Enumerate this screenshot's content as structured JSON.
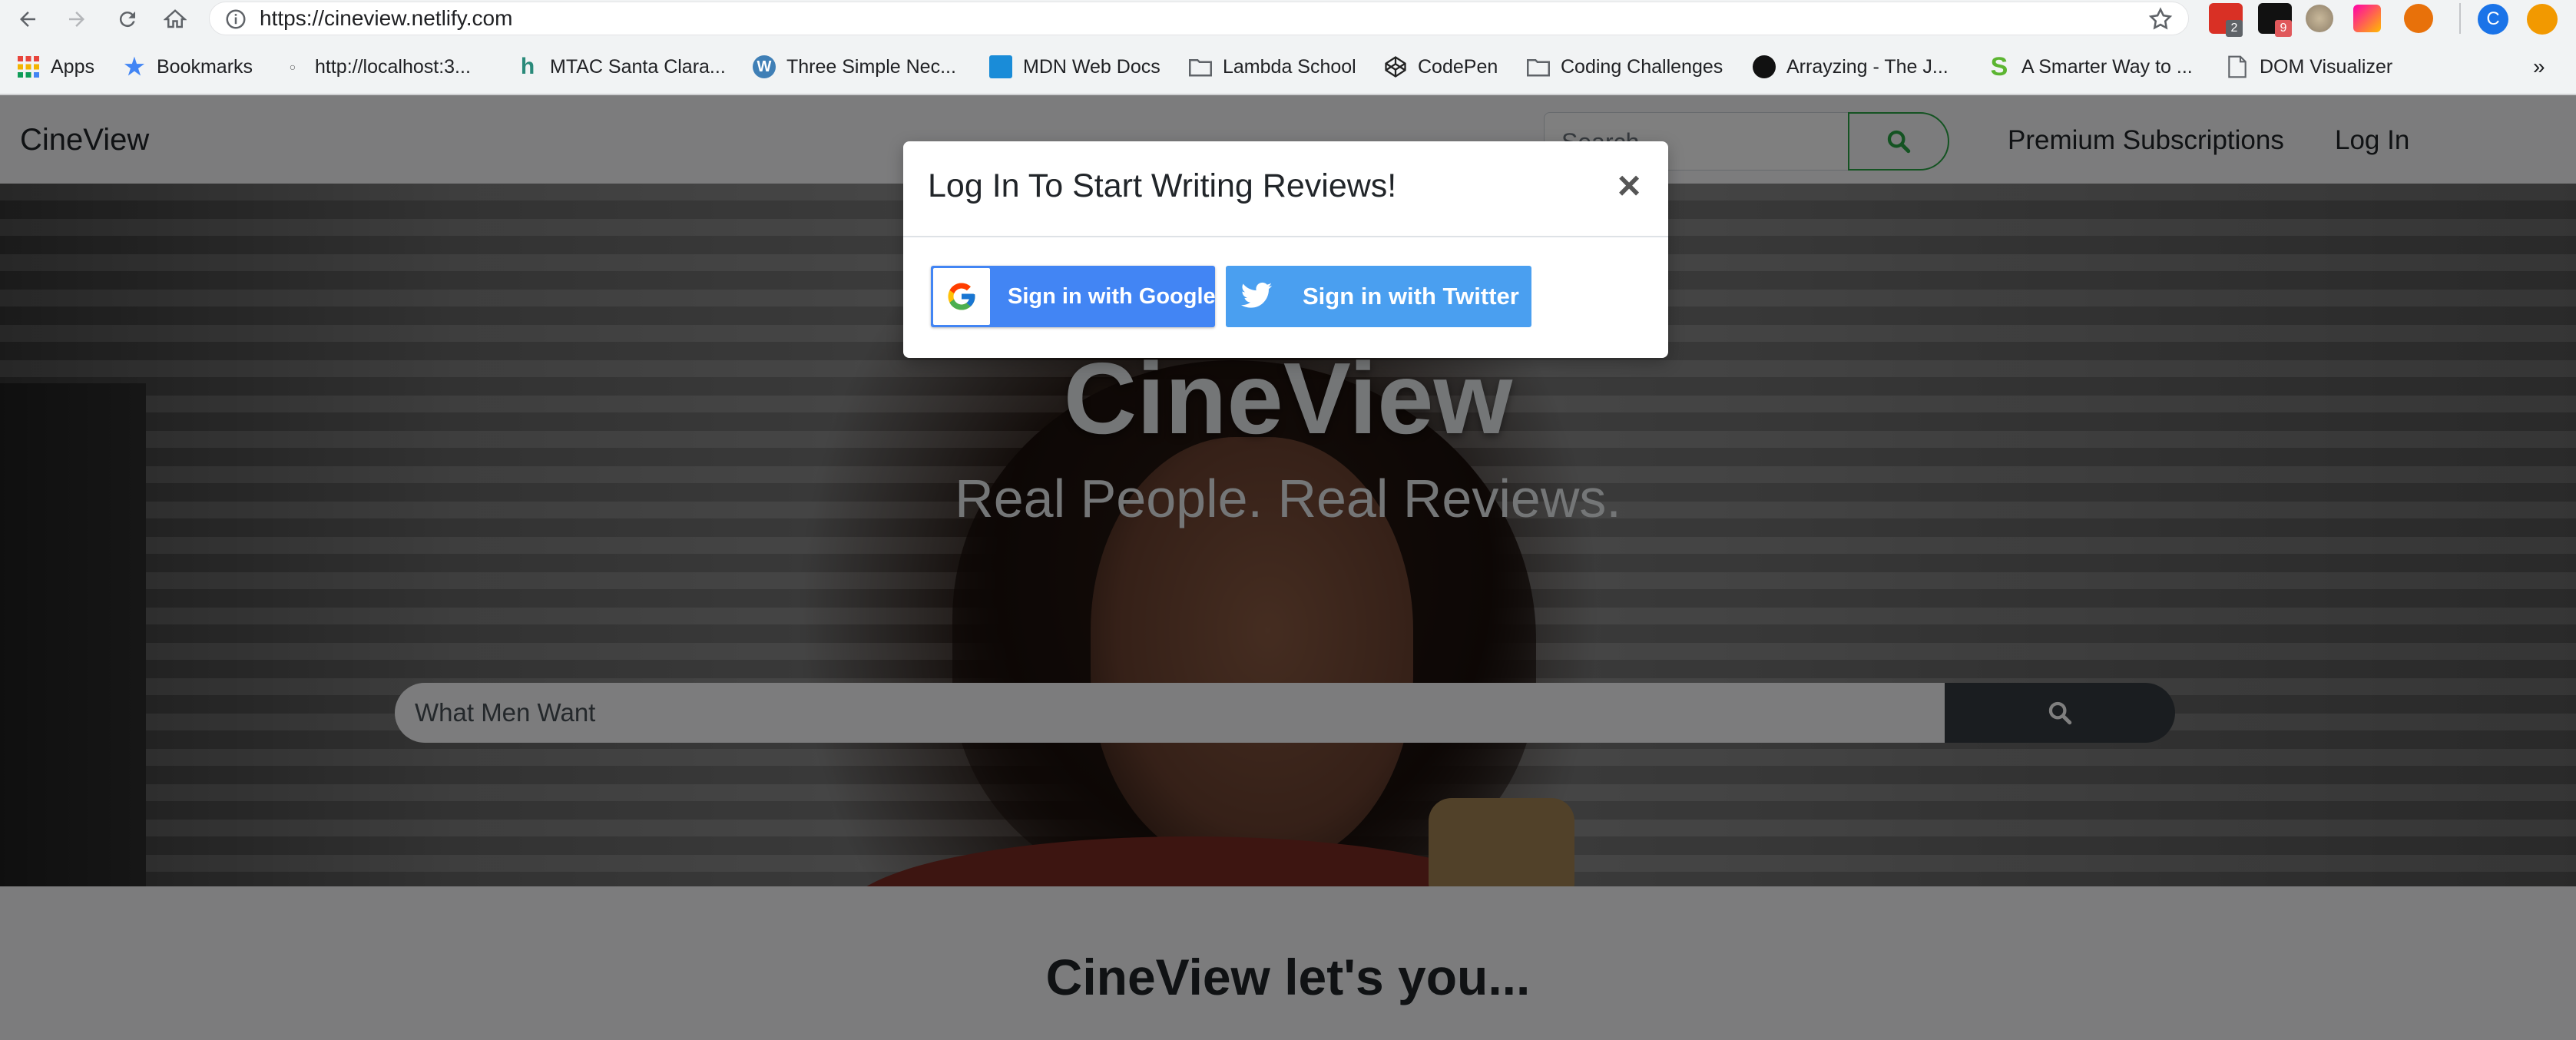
{
  "browser": {
    "url": "https://cineview.netlify.com",
    "extension_badges": [
      "2",
      "9"
    ],
    "profile_initial": "C",
    "bookmarks": [
      {
        "label": "Apps",
        "icon": "apps-grid-icon"
      },
      {
        "label": "Bookmarks",
        "icon": "star-icon"
      },
      {
        "label": "http://localhost:3...",
        "icon": "localhost-icon"
      },
      {
        "label": "MTAC Santa Clara...",
        "icon": "mtac-icon"
      },
      {
        "label": "Three Simple Nec...",
        "icon": "wordpress-icon"
      },
      {
        "label": "MDN Web Docs",
        "icon": "mdn-icon"
      },
      {
        "label": "Lambda School",
        "icon": "folder-icon"
      },
      {
        "label": "CodePen",
        "icon": "codepen-icon"
      },
      {
        "label": "Coding Challenges",
        "icon": "folder-icon"
      },
      {
        "label": "Arrayzing - The J...",
        "icon": "github-icon"
      },
      {
        "label": "A Smarter Way to ...",
        "icon": "smarter-way-icon"
      },
      {
        "label": "DOM Visualizer",
        "icon": "page-icon"
      }
    ],
    "overflow_label": "»"
  },
  "navbar": {
    "brand": "CineView",
    "search_placeholder": "Search",
    "premium_label": "Premium Subscriptions",
    "login_label": "Log In"
  },
  "hero": {
    "title": "CineView",
    "subtitle": "Real People. Real Reviews.",
    "search_value": "What Men Want"
  },
  "section": {
    "title": "CineView let's you..."
  },
  "modal": {
    "title": "Log In To Start Writing Reviews!",
    "close_label": "×",
    "google_label": "Sign in with Google",
    "twitter_label": "Sign in with Twitter"
  },
  "colors": {
    "google_blue": "#4285f4",
    "twitter_blue": "#4a9ff0",
    "success_green": "#28a745",
    "dark_button": "#343a40"
  }
}
